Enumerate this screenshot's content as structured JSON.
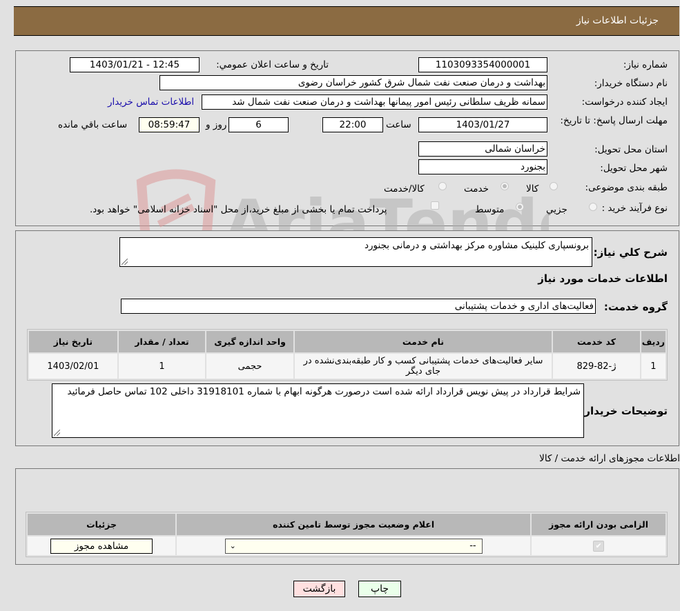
{
  "header": {
    "title": "جزئیات اطلاعات نیاز"
  },
  "form": {
    "need_number": {
      "label": "شماره نیاز:",
      "value": "1103093354000001"
    },
    "announce_datetime": {
      "label": "تاریخ و ساعت اعلان عمومي:",
      "value": "1403/01/21 - 12:45"
    },
    "buyer_org": {
      "label": "نام دستگاه خريدار:",
      "value": "بهداشت و درمان صنعت نفت شمال شرق کشور   خراسان رضوی"
    },
    "requester": {
      "label": "ایجاد کننده درخواست:",
      "value": "سمانه ظریف سلطانی رئیس امور پیمانها بهداشت و درمان صنعت نفت شمال شد",
      "contact_link": "اطلاعات تماس خريدار"
    },
    "deadline": {
      "label": "مهلت ارسال پاسخ: تا تاریخ:",
      "date": "1403/01/27",
      "time_label": "ساعت",
      "time": "22:00",
      "days": "6",
      "days_label": "روز و",
      "remaining": "08:59:47",
      "remaining_label": "ساعت باقي مانده"
    },
    "delivery_province": {
      "label": "استان محل تحویل:",
      "value": "خراسان شمالی"
    },
    "delivery_city": {
      "label": "شهر محل تحویل:",
      "value": "بجنورد"
    },
    "category": {
      "label": "طبقه بندی موضوعی:",
      "options": [
        {
          "label": "کالا",
          "checked": false
        },
        {
          "label": "خدمت",
          "checked": true
        },
        {
          "label": "کالا/خدمت",
          "checked": false
        }
      ]
    },
    "purchase_type": {
      "label": "نوع فرآیند خرید :",
      "options": [
        {
          "label": "جزيي",
          "checked": false
        },
        {
          "label": "متوسط",
          "checked": true
        }
      ],
      "treasury_checkbox_label": "پرداخت تمام یا بخشی از مبلغ خرید،از محل \"اسناد خزانه اسلامی\" خواهد بود.",
      "treasury_checked": false
    }
  },
  "summary": {
    "description_label": "شرح کلي نياز:",
    "description_value": "برونسپاری کلینیک مشاوره مرکز بهداشتی و درمانی بجنورد",
    "services_heading": "اطلاعات خدمات مورد نیاز",
    "service_group_label": "گروه خدمت:",
    "service_group_value": "فعالیت‌های اداری و خدمات پشتیبانی"
  },
  "services_table": {
    "headers": [
      "رديف",
      "کد خدمت",
      "نام خدمت",
      "واحد اندازه گيری",
      "تعداد / مقدار",
      "تاریخ نیاز"
    ],
    "rows": [
      [
        "1",
        "ژ-82-829",
        "سایر فعالیت‌های خدمات پشتیبانی کسب و کار طبقه‌بندی‌نشده در جای دیگر",
        "حجمی",
        "1",
        "1403/02/01"
      ]
    ]
  },
  "buyer_notes": {
    "label": "توضیحات خریدار:",
    "value": "شرایط قرارداد در پیش نویس قرارداد ارائه شده است درصورت هرگونه ابهام با شماره 31918101 داخلی 102 تماس حاصل فرمائید"
  },
  "licenses": {
    "heading": "اطلاعات مجوزهای ارائه خدمت / کالا",
    "headers": [
      "الزامی بودن ارائه مجوز",
      "اعلام وضعیت مجوز توسط تامین کننده",
      "جزئیات"
    ],
    "rows": [
      {
        "required": true,
        "status_value": "--",
        "details_button": "مشاهده مجوز"
      }
    ]
  },
  "footer": {
    "print_button": "چاپ",
    "back_button": "بازگشت"
  },
  "watermark": {
    "text": "AriaTender.neT"
  },
  "colors": {
    "header_bg": "#8b6b42",
    "link": "#1a0dab",
    "back_btn": "#ffe0e0",
    "print_btn": "#eaffea"
  }
}
